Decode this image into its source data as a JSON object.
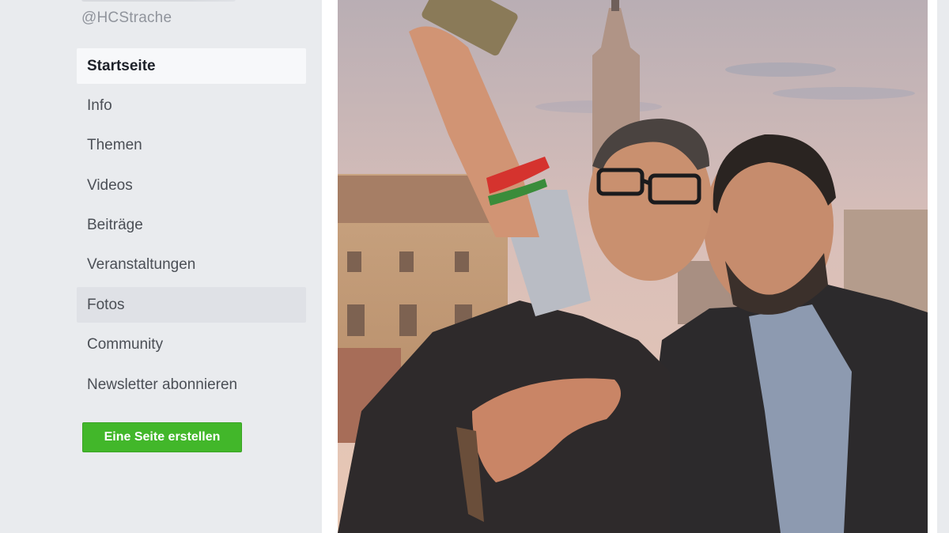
{
  "page": {
    "handle": "@HCStrache"
  },
  "nav": {
    "items": [
      {
        "label": "Startseite",
        "state": "active"
      },
      {
        "label": "Info",
        "state": "normal"
      },
      {
        "label": "Themen",
        "state": "normal"
      },
      {
        "label": "Videos",
        "state": "normal"
      },
      {
        "label": "Beiträge",
        "state": "normal"
      },
      {
        "label": "Veranstaltungen",
        "state": "normal"
      },
      {
        "label": "Fotos",
        "state": "hover"
      },
      {
        "label": "Community",
        "state": "normal"
      },
      {
        "label": "Newsletter abonnieren",
        "state": "normal"
      }
    ]
  },
  "actions": {
    "create_page_label": "Eine Seite erstellen"
  },
  "colors": {
    "page_bg": "#e9ebee",
    "create_button": "#42b72a",
    "nav_text": "#4b4f56",
    "handle_text": "#90949c"
  }
}
